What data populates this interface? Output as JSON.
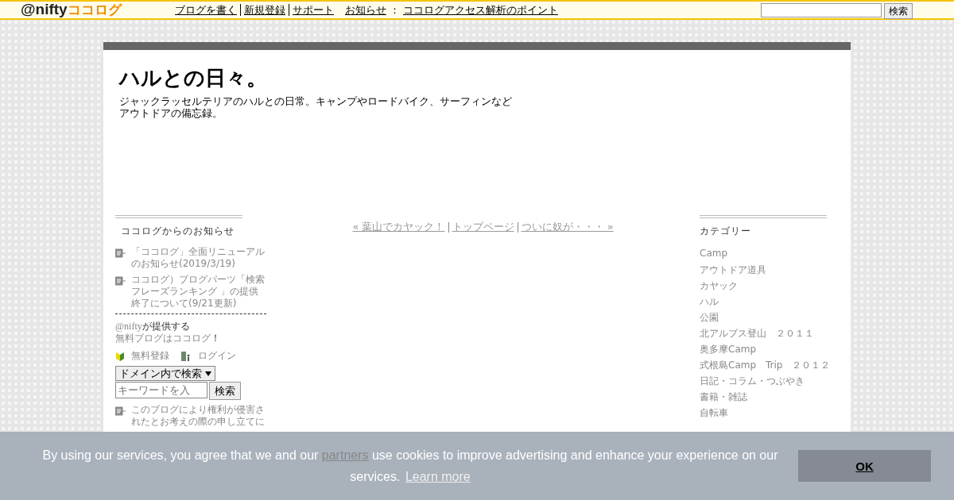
{
  "header": {
    "logo_at": "@nifty",
    "logo_brand": "ココログ",
    "links": [
      {
        "label": "ブログを書く"
      },
      {
        "label": "新規登録"
      },
      {
        "label": "サポート"
      }
    ],
    "news_label": "お知らせ",
    "news_sep": "：",
    "news_link": "ココログアクセス解析のポイント",
    "search_button": "検索"
  },
  "blog": {
    "title": "ハルとの日々。",
    "description": "ジャックラッセルテリアのハルとの日常。キャンプやロードバイク、サーフィンなどアウトドアの備忘録。"
  },
  "left_sidebar": {
    "heading": "ココログからのお知らせ",
    "notices": [
      "「ココログ」全面リニューアルのお知らせ(2019/3/19)",
      "ココログ）ブログパーツ「検索フレーズランキング 」の提供終了について(9/21更新)"
    ],
    "promo_line1_a": "@nifty",
    "promo_line1_b": "が提供する",
    "promo_line2_link": "無料ブログはココログ",
    "promo_line2_end": "！",
    "register": "無料登録",
    "login": "ログイン",
    "search_scope": "ドメイン内で検索",
    "keyword_placeholder": "キーワードを入",
    "search_button": "検索",
    "report": "このブログにより権利が侵害されたとお考えの際の申し立てに"
  },
  "post_nav": {
    "prev": "« 葉山でカヤック！",
    "top": "トップページ",
    "next": "ついに奴が・・・ »"
  },
  "right_sidebar": {
    "heading": "カテゴリー",
    "categories": [
      "Camp",
      "アウトドア道具",
      "カヤック",
      "ハル",
      "公園",
      "北アルプス登山　２０１１",
      "奥多摩Camp",
      "式根島Camp　Trip　２０１２",
      "日記・コラム・つぶやき",
      "書籍・雑誌",
      "自転車"
    ]
  },
  "cookie_banner": {
    "text_before": "By using our services, you agree that we and our",
    "partners": "partners",
    "text_after": "use cookies to improve advertising and enhance your experience on our services.",
    "learn_more": "Learn more",
    "ok": "OK"
  }
}
